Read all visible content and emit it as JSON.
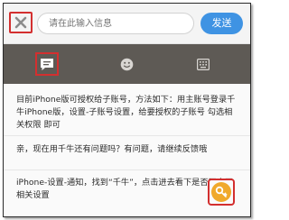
{
  "search": {
    "placeholder": "请在此输入信息"
  },
  "toolbar": {
    "send_label": "发送"
  },
  "tabs": [
    {
      "icon": "chat-icon",
      "selected": true
    },
    {
      "icon": "emoji-icon",
      "selected": false
    },
    {
      "icon": "keyboard-icon",
      "selected": false
    }
  ],
  "messages": [
    {
      "text": "目前iPhone版可授权给子账号，方法如下：用主账号登录千牛iPhone版，设置-子账号设置，给要授权的子账号 勾选相关权限 即可"
    },
    {
      "text": "亲，现在用千牛还有问题吗？有问题，请继续反馈哦"
    },
    {
      "text": "iPhone-设置-通知，找到“千牛”，点击进去看下是否开启了相关设置"
    }
  ],
  "colors": {
    "accent": "#3f93e3",
    "highlight": "#d32f2f",
    "tab_bar": "#5e5a55",
    "badge": "#f0a92b"
  },
  "floating_button": {
    "icon": "key-icon"
  }
}
